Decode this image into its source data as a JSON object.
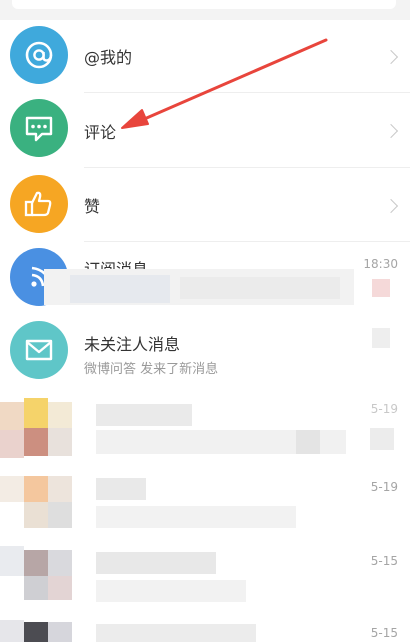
{
  "menu": {
    "items": [
      {
        "label": "@我的",
        "icon": "at-icon",
        "color": "#3fa9dc"
      },
      {
        "label": "评论",
        "icon": "comment-icon",
        "color": "#3ab180"
      },
      {
        "label": "赞",
        "icon": "thumbs-up-icon",
        "color": "#f6a623"
      }
    ]
  },
  "messages": {
    "subscription": {
      "title": "订阅消息",
      "time": "18:30",
      "color": "#4a90e2"
    },
    "unfollowed": {
      "title": "未关注人消息",
      "preview": "微博问答 发来了新消息",
      "color": "#5fc6c8"
    },
    "blurred": [
      {
        "time": "5-19"
      },
      {
        "time": "5-19"
      },
      {
        "time": "5-15"
      },
      {
        "time": "5-15"
      }
    ]
  },
  "annotation": {
    "color": "#e8453c"
  }
}
